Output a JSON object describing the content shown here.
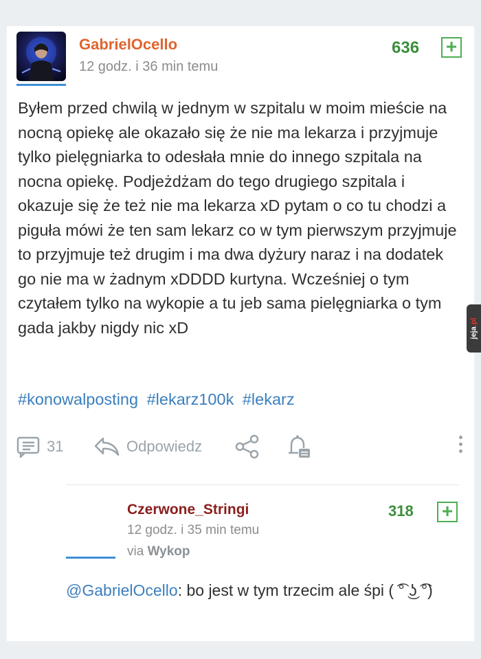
{
  "post": {
    "username": "GabrielOcello",
    "time": "12 godz. i 36 min temu",
    "votes": "636",
    "plus_label": "+",
    "body": "Byłem przed chwilą w jednym w szpitalu w moim mieście na nocną opiekę ale okazało się że nie ma lekarza i przyjmuje tylko pielęgniarka to odesłała mnie do innego szpitala na nocna opiekę. Podjeżdżam do tego drugiego szpitala i okazuje się że też nie ma lekarza xD pytam o co tu chodzi a piguła mówi że ten sam lekarz co w tym pierwszym przyjmuje to przyjmuje też drugim i ma dwa dyżury naraz i na dodatek go nie ma w żadnym xDDDD kurtyna. Wcześniej o tym czytałem tylko na wykopie a tu jeb sama pielęgniarka o tym gada jakby nigdy nic xD",
    "tags": [
      "#konowalposting",
      "#lekarz100k",
      "#lekarz"
    ],
    "comments_count": "31",
    "reply_label": "Odpowiedz"
  },
  "reply": {
    "username": "Czerwone_Stringi",
    "time": "12 godz. i 35 min temu",
    "via_prefix": "via",
    "via_app": "Wykop",
    "votes": "318",
    "plus_label": "+",
    "mention": "@GabrielOcello",
    "text": ": bo jest w tym trzecim ale śpi ( ͡° ͜ʖ ͡°)"
  },
  "watermark": {
    "brand": "jeja",
    "suffix": ".pl"
  },
  "colors": {
    "op_username": "#e0632e",
    "reply_username": "#8b1e1e",
    "votes": "#3c8e3c",
    "link": "#3b7fbd",
    "muted": "#9aa4ab"
  },
  "icons": [
    "comments-icon",
    "reply-arrow-icon",
    "share-icon",
    "notification-bell-icon",
    "more-options-icon",
    "plus-vote-icon"
  ]
}
